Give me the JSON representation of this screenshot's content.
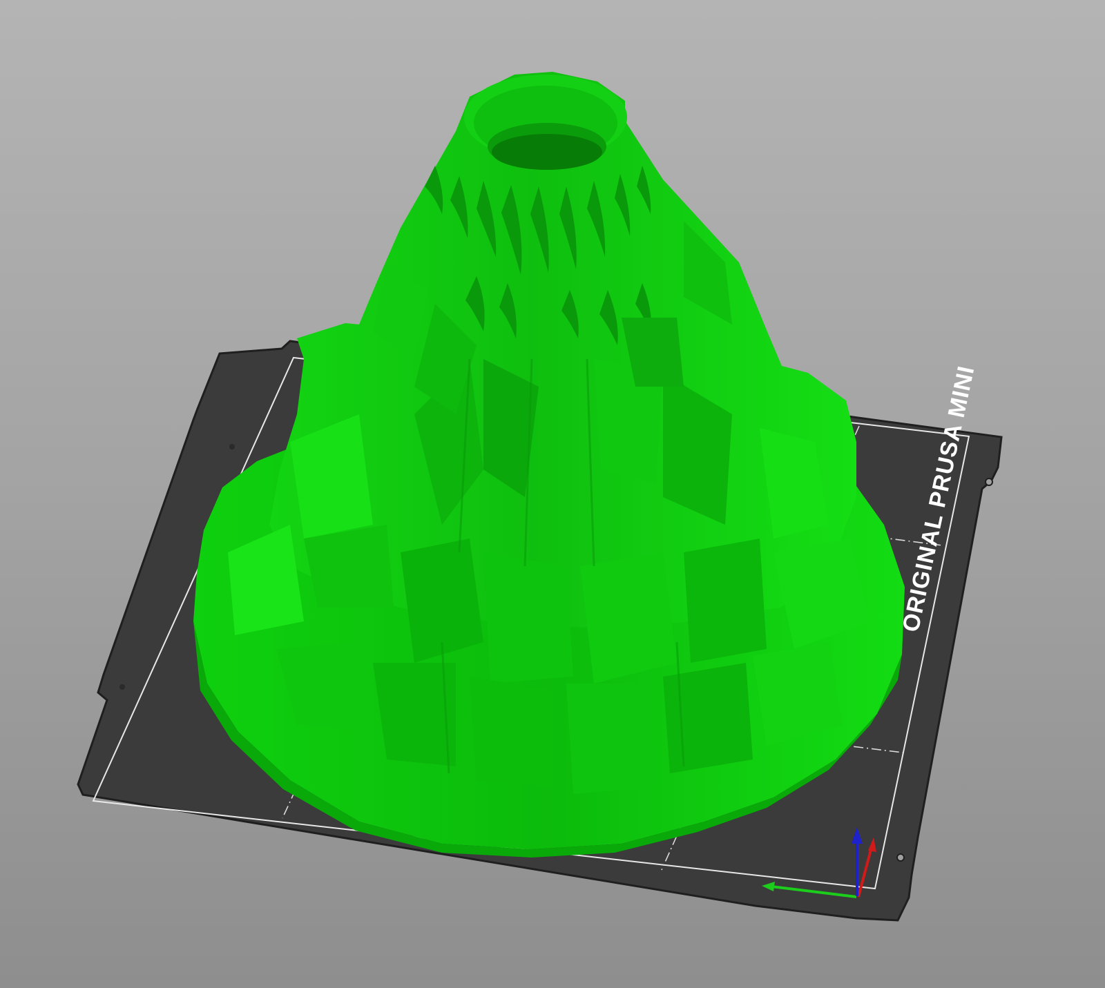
{
  "app": {
    "view": "3D plater view"
  },
  "bed": {
    "label": "ORIGINAL PRUSA MINI",
    "color": "#3a3a3a",
    "outline_color": "#1e1e1e",
    "grid_color": "#e6e6e6"
  },
  "model": {
    "color": "#19e619",
    "shape": "volcano"
  },
  "axes": {
    "x_color": "#d11a1a",
    "y_color": "#1ccd1c",
    "z_color": "#1d22cc"
  }
}
